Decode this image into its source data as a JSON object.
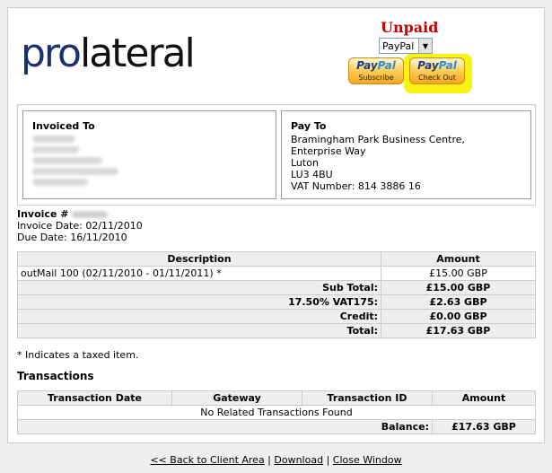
{
  "logo": {
    "part1": "pro",
    "part2": "lateral"
  },
  "invoice": {
    "status": "Unpaid",
    "payment_method": "PayPal",
    "paypal_buttons": [
      {
        "brand_pay": "Pay",
        "brand_pal": "Pal",
        "label": "Subscribe"
      },
      {
        "brand_pay": "Pay",
        "brand_pal": "Pal",
        "label": "Check Out"
      }
    ],
    "invoiced_to_heading": "Invoiced To",
    "pay_to_heading": "Pay To",
    "pay_to_lines": [
      "Bramingham Park Business Centre,",
      "Enterprise Way",
      "Luton",
      "LU3 4BU",
      "VAT Number: 814 3886 16"
    ],
    "number_label": "Invoice #",
    "invoice_date": "Invoice Date: 02/11/2010",
    "due_date": "Due Date: 16/11/2010"
  },
  "items_table": {
    "headers": [
      "Description",
      "Amount"
    ],
    "rows": [
      {
        "description": "outMail 100 (02/11/2010 - 01/11/2011) *",
        "amount": "£15.00 GBP"
      }
    ],
    "totals": [
      {
        "label": "Sub Total:",
        "value": "£15.00 GBP"
      },
      {
        "label": "17.50% VAT175:",
        "value": "£2.63 GBP"
      },
      {
        "label": "Credit:",
        "value": "£0.00 GBP"
      },
      {
        "label": "Total:",
        "value": "£17.63 GBP"
      }
    ]
  },
  "taxed_note": "* Indicates a taxed item.",
  "transactions": {
    "title": "Transactions",
    "headers": [
      "Transaction Date",
      "Gateway",
      "Transaction ID",
      "Amount"
    ],
    "empty": "No Related Transactions Found",
    "balance_label": "Balance:",
    "balance_value": "£17.63 GBP"
  },
  "footer": {
    "back": "<< Back to Client Area",
    "sep": " | ",
    "download": "Download",
    "close": "Close Window"
  }
}
